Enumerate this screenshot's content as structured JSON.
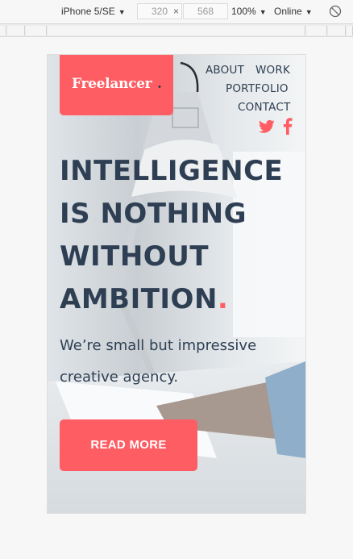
{
  "devtools": {
    "device": "iPhone 5/SE",
    "width": "320",
    "height": "568",
    "times": "×",
    "zoom": "100%",
    "network": "Online",
    "caret": "▼",
    "rotate_icon": "rotate-icon"
  },
  "site": {
    "logo": {
      "text": "Freelancer",
      "dot": "."
    },
    "nav": {
      "about": "ABOUT",
      "work": "WORK",
      "portfolio": "PORTFOLIO",
      "contact": "CONTACT"
    },
    "social": [
      "twitter-icon",
      "facebook-icon"
    ],
    "hero": {
      "headline_lines": [
        "INTELLIGENCE",
        "IS NOTHING",
        "WITHOUT",
        "AMBITION"
      ],
      "headline_dot": ".",
      "subtitle_lines": [
        "We’re small but impressive",
        "creative agency."
      ]
    },
    "cta": "READ MORE"
  },
  "colors": {
    "accent": "#fe5d63",
    "text": "#2e3f53",
    "chrome": "#f7f7f7"
  }
}
